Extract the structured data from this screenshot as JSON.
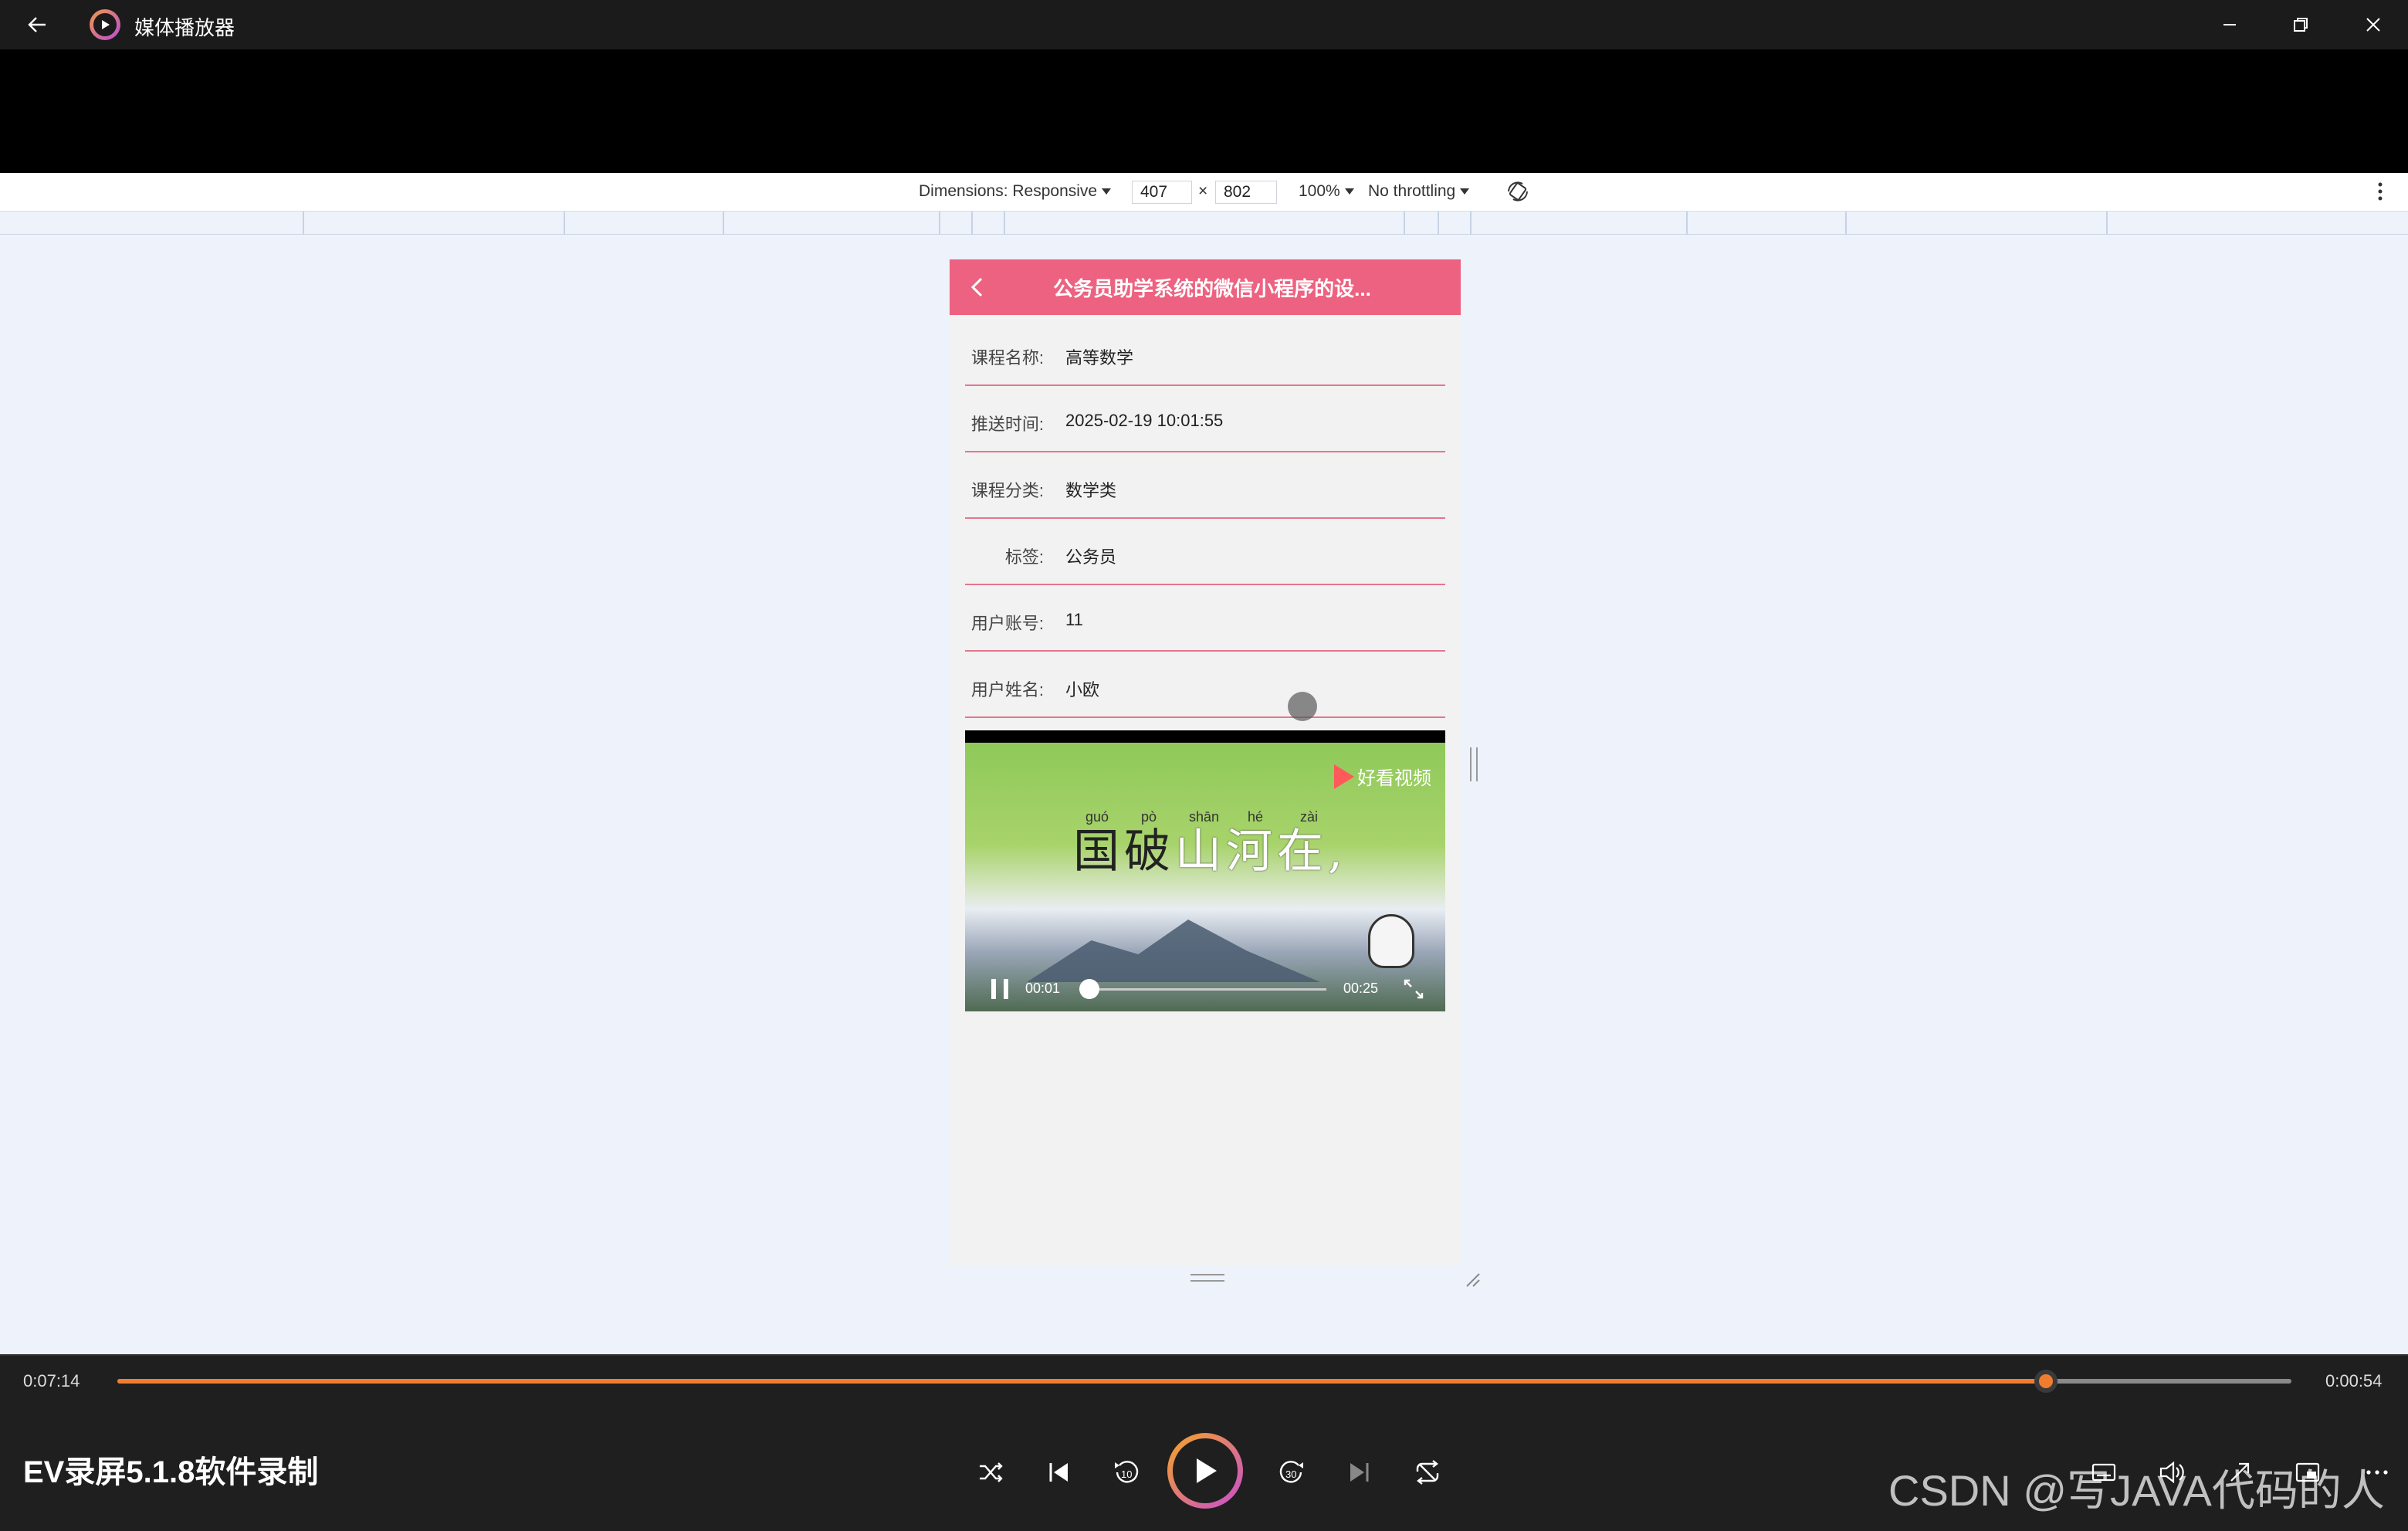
{
  "titlebar": {
    "app_title": "媒体播放器"
  },
  "devtools": {
    "dimensions_label": "Dimensions: Responsive",
    "width": "407",
    "times": "×",
    "height": "802",
    "zoom": "100%",
    "throttling": "No throttling"
  },
  "phone": {
    "title": "公务员助学系统的微信小程序的设...",
    "fields": [
      {
        "label": "课程名称:",
        "value": "高等数学"
      },
      {
        "label": "推送时间:",
        "value": "2025-02-19 10:01:55"
      },
      {
        "label": "课程分类:",
        "value": "数学类"
      },
      {
        "label": "标签:",
        "value": "公务员"
      },
      {
        "label": "用户账号:",
        "value": "11"
      },
      {
        "label": "用户姓名:",
        "value": "小欧"
      }
    ],
    "video": {
      "logo": "好看视频",
      "pinyin": [
        "guó",
        "pò",
        "shān",
        "hé",
        "zài"
      ],
      "poem_first": "国破",
      "poem_rest": "山河在,",
      "current_time": "00:01",
      "duration": "00:25",
      "progress": 0.04
    }
  },
  "player": {
    "elapsed": "0:07:14",
    "remaining": "0:00:54",
    "progress": 0.887,
    "title": "EV录屏5.1.8软件录制",
    "watermark": "CSDN @写JAVA代码的人"
  }
}
